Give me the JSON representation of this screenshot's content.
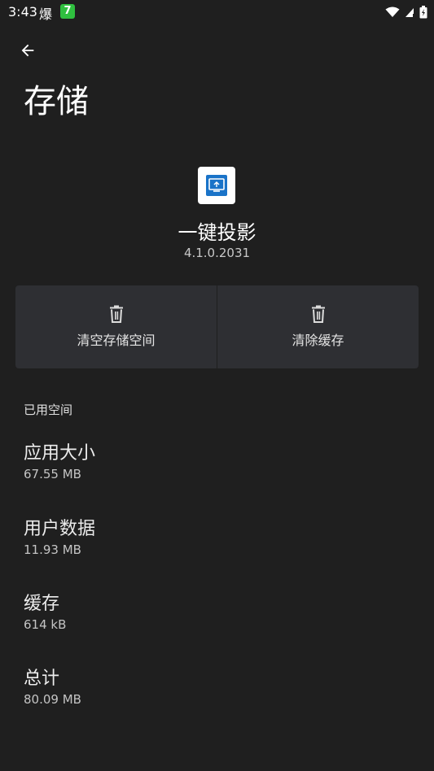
{
  "status_bar": {
    "time": "3:43",
    "notif_glyph": "爆",
    "notif_badge": "7"
  },
  "header": {
    "title": "存储"
  },
  "app": {
    "name": "一键投影",
    "version": "4.1.0.2031",
    "icon": "cast-screen-icon"
  },
  "actions": {
    "clear_storage_label": "清空存储空间",
    "clear_cache_label": "清除缓存"
  },
  "section": {
    "title": "已用空间"
  },
  "items": [
    {
      "title": "应用大小",
      "value": "67.55 MB"
    },
    {
      "title": "用户数据",
      "value": "11.93 MB"
    },
    {
      "title": "缓存",
      "value": "614 kB"
    },
    {
      "title": "总计",
      "value": "80.09 MB"
    }
  ],
  "colors": {
    "background": "#1f1f1f",
    "button_background": "#2e2f33",
    "app_icon_blue": "#1a73c8",
    "notif_green": "#2fbf3f"
  }
}
